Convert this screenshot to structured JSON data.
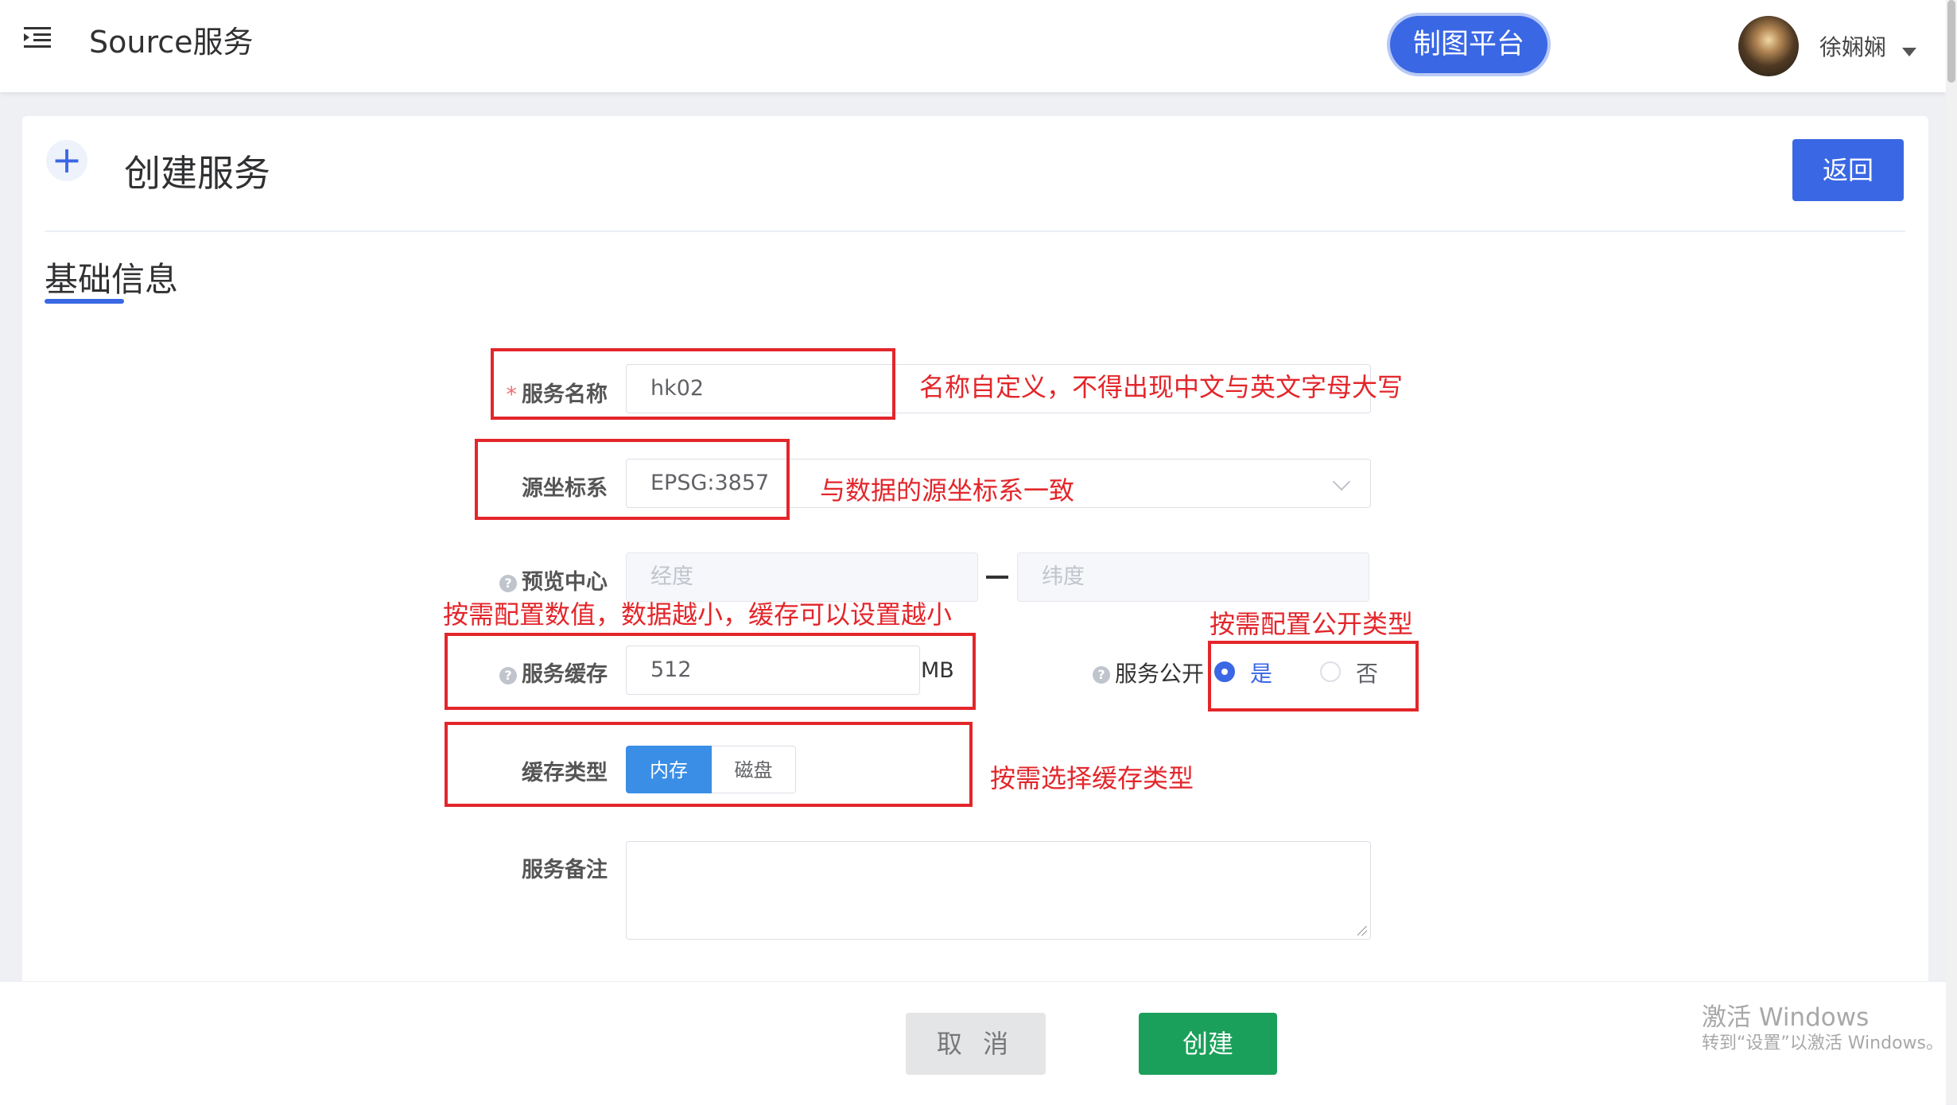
{
  "header": {
    "app_title": "Source服务",
    "platform_button": "制图平台",
    "username": "徐娴娴"
  },
  "page": {
    "title": "创建服务",
    "back_button": "返回",
    "section_title": "基础信息"
  },
  "form": {
    "service_name": {
      "label": "服务名称",
      "required_mark": "*",
      "value": "hk02"
    },
    "source_crs": {
      "label": "源坐标系",
      "value": "EPSG:3857"
    },
    "preview_center": {
      "label": "预览中心",
      "lon_placeholder": "经度",
      "lat_placeholder": "纬度"
    },
    "service_cache": {
      "label": "服务缓存",
      "value": "512",
      "unit": "MB"
    },
    "service_public": {
      "label": "服务公开",
      "options": [
        "是",
        "否"
      ],
      "selected": "是"
    },
    "cache_type": {
      "label": "缓存类型",
      "options": [
        "内存",
        "磁盘"
      ],
      "selected": "内存"
    },
    "service_notes": {
      "label": "服务备注",
      "value": ""
    }
  },
  "annotations": {
    "name_note": "名称自定义，不得出现中文与英文字母大写",
    "crs_note": "与数据的源坐标系一致",
    "cache_note": "按需配置数值，数据越小，缓存可以设置越小",
    "public_note": "按需配置公开类型",
    "cache_type_note": "按需选择缓存类型"
  },
  "footer": {
    "cancel_button": "取 消",
    "create_button": "创建"
  },
  "watermark": {
    "line1": "激活 Windows",
    "line2": "转到“设置”以激活 Windows。"
  },
  "colors": {
    "primary": "#3a67e4",
    "success": "#1aa05a",
    "annotation_red": "#e3262b"
  }
}
